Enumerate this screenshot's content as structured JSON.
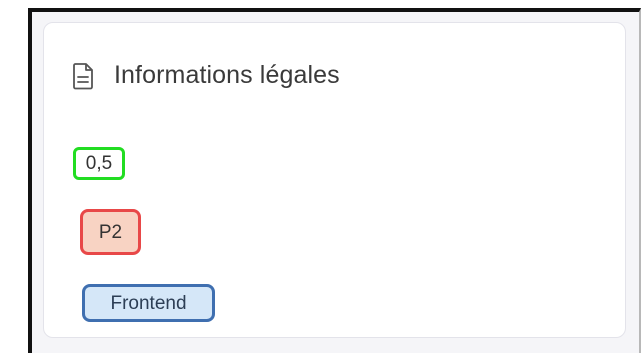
{
  "card": {
    "title": "Informations légales",
    "icon": "document-icon"
  },
  "badges": {
    "weight": "0,5",
    "priority": "P2",
    "area": "Frontend"
  },
  "colors": {
    "weight_border": "#22dd22",
    "priority_border": "#e84848",
    "priority_fill": "#f8d3c3",
    "area_border": "#3f6fb0",
    "area_fill": "#d5e7f8"
  }
}
